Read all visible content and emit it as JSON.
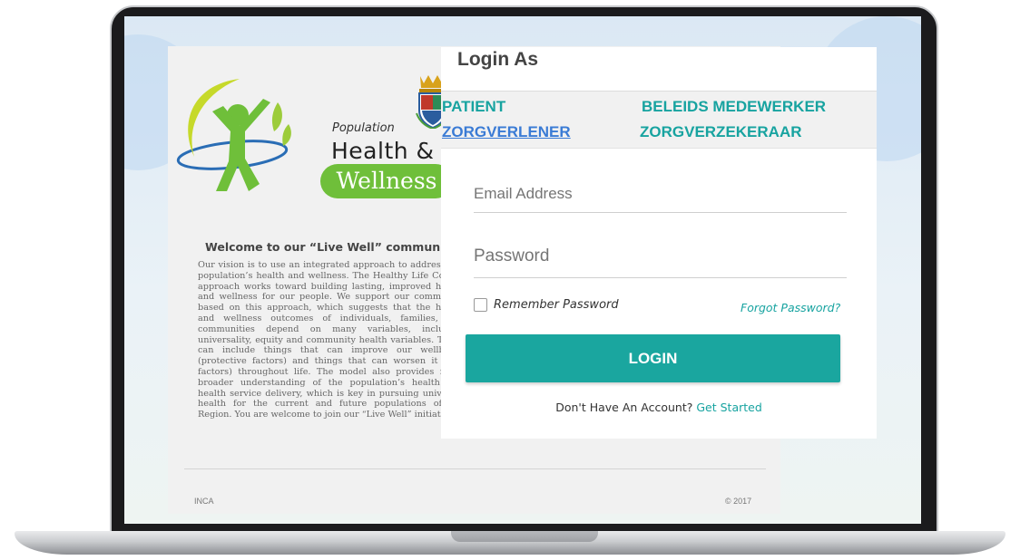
{
  "brand": {
    "population": "Population",
    "health": "Health &",
    "wellness": "Wellness",
    "green": "#6fbf3a"
  },
  "welcome": {
    "title": "Welcome to our “Live Well” community",
    "text": "Our vision is to use an integrated approach to address our population’s health and wellness. The Healthy Life Course approach works toward building lasting, improved health and wellness for our people. We support our community based on this approach, which suggests that the health and wellness outcomes of individuals, families, and communities depend on many variables, including universality, equity and community health variables. These can include things that can improve our wellbeing (protective factors) and things that can worsen it (risk factors) throughout life. The model also provides for a broader understanding of the population’s health and health service delivery, which is key in pursuing universal health for the current and future populations of the Region. You are welcome to join our “Live Well” initiative!"
  },
  "footer": {
    "left": "INCA",
    "right": "© 2017"
  },
  "login": {
    "title": "Login As",
    "roles": [
      {
        "label": "PATIENT",
        "active": false
      },
      {
        "label": "BELEIDS MEDEWERKER",
        "active": false
      },
      {
        "label": "ZORGVERLENER",
        "active": true
      },
      {
        "label": "ZORGVERZEKERAAR",
        "active": false
      }
    ],
    "email_placeholder": "Email Address",
    "password_placeholder": "Password",
    "remember_label": "Remember Password",
    "forgot_label": "Forgot Password?",
    "button_label": "LOGIN",
    "no_account": "Don't Have An Account?",
    "get_started": "Get Started",
    "accent": "#1aa69f",
    "active_role_color": "#3a7bd5"
  }
}
